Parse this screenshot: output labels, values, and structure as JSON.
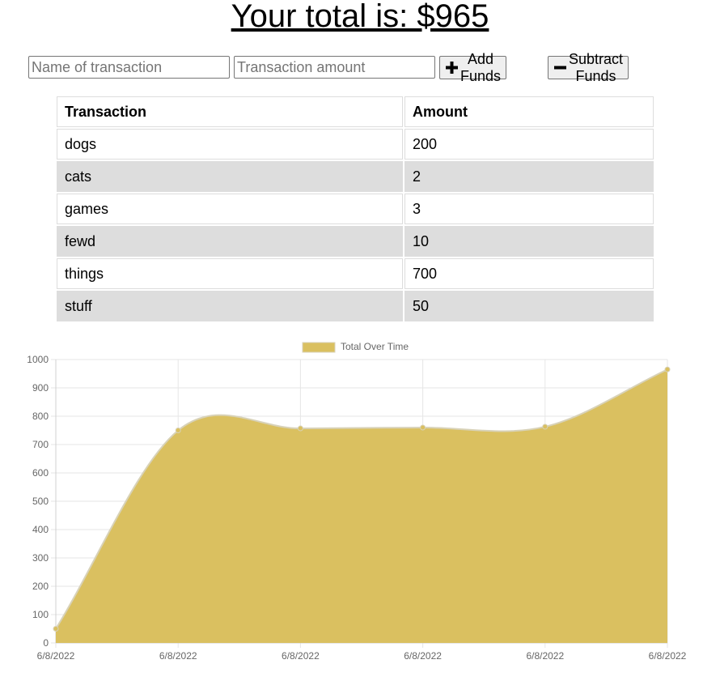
{
  "header": {
    "total_text": "Your total is: $965"
  },
  "form": {
    "name_placeholder": "Name of transaction",
    "amount_placeholder": "Transaction amount",
    "add_label": "Add Funds",
    "subtract_label": "Subtract Funds"
  },
  "table": {
    "headers": [
      "Transaction",
      "Amount"
    ],
    "rows": [
      {
        "name": "dogs",
        "amount": "200"
      },
      {
        "name": "cats",
        "amount": "2"
      },
      {
        "name": "games",
        "amount": "3"
      },
      {
        "name": "fewd",
        "amount": "10"
      },
      {
        "name": "things",
        "amount": "700"
      },
      {
        "name": "stuff",
        "amount": "50"
      }
    ]
  },
  "chart_data": {
    "type": "area",
    "x": [
      "6/8/2022",
      "6/8/2022",
      "6/8/2022",
      "6/8/2022",
      "6/8/2022",
      "6/8/2022"
    ],
    "series": [
      {
        "name": "Total Over Time",
        "values": [
          50,
          750,
          757,
          760,
          763,
          965
        ],
        "color": "#dac060"
      }
    ],
    "ylim": [
      0,
      1000
    ],
    "yticks": [
      0,
      100,
      200,
      300,
      400,
      500,
      600,
      700,
      800,
      900,
      1000
    ],
    "grid": true,
    "legend": "top-center",
    "title": "",
    "xlabel": "",
    "ylabel": ""
  }
}
